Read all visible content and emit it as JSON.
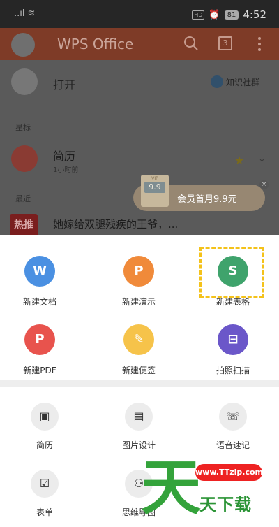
{
  "status_bar": {
    "signal": "..ıl",
    "battery": "81",
    "hd": "HD",
    "time": "4:52"
  },
  "header": {
    "title": "WPS Office",
    "tabs_count": "3"
  },
  "list": {
    "open_label": "打开",
    "community_label": "知识社群",
    "starred_section": "星标",
    "starred_item": {
      "title": "简历",
      "time": "1小时前"
    },
    "recent_section": "最近",
    "news_badge": "热推",
    "news_title": "她嫁给双腿残疾的王爷，..."
  },
  "promo": {
    "card_top": "VIP",
    "price": "9.9",
    "text": "会员首月9.9元"
  },
  "create_grid": [
    {
      "label": "新建文档",
      "glyph": "W",
      "color": "#4a90e2"
    },
    {
      "label": "新建演示",
      "glyph": "P",
      "color": "#f08a3a"
    },
    {
      "label": "新建表格",
      "glyph": "S",
      "color": "#3fa36c"
    },
    {
      "label": "新建PDF",
      "glyph": "P",
      "color": "#e8534d"
    },
    {
      "label": "新建便签",
      "glyph": "✎",
      "color": "#f6c34a"
    },
    {
      "label": "拍照扫描",
      "glyph": "⊟",
      "color": "#6b57c9"
    }
  ],
  "tools_grid": [
    {
      "label": "简历",
      "glyph": "▣"
    },
    {
      "label": "图片设计",
      "glyph": "▤"
    },
    {
      "label": "语音速记",
      "glyph": "☏"
    },
    {
      "label": "表单",
      "glyph": "☑"
    },
    {
      "label": "思维导图",
      "glyph": "⚇"
    }
  ],
  "watermark": {
    "big": "天",
    "url": "www.TTzip.com",
    "text": "天下载"
  }
}
